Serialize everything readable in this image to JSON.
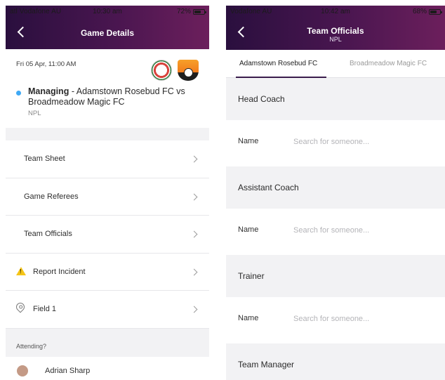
{
  "left_screen": {
    "status_bar": {
      "carrier": "atl Vodafone AU",
      "time": "10:30 am",
      "battery": "72%",
      "battery_level": 0.72
    },
    "header": {
      "title": "Game Details"
    },
    "game": {
      "date": "Fri 05 Apr, 11:00 AM",
      "status": "Managing",
      "matchup": " - Adamstown Rosebud FC vs Broadmeadow Magic FC",
      "league": "NPL"
    },
    "menu": [
      {
        "label": "Team Sheet"
      },
      {
        "label": "Game Referees"
      },
      {
        "label": "Team Officials"
      },
      {
        "label": "Report Incident"
      },
      {
        "label": "Field 1"
      }
    ],
    "attending": {
      "heading": "Attending?",
      "name": "Adrian Sharp"
    }
  },
  "right_screen": {
    "status_bar": {
      "carrier": "Vodafone AU",
      "time": "10:42 am",
      "battery": "68%",
      "battery_level": 0.68
    },
    "header": {
      "title": "Team Officials",
      "subtitle": "NPL"
    },
    "tabs": [
      {
        "label": "Adamstown Rosebud FC"
      },
      {
        "label": "Broadmeadow Magic FC"
      }
    ],
    "sections": [
      {
        "title": "Head Coach",
        "field_label": "Name",
        "placeholder": "Search for someone..."
      },
      {
        "title": "Assistant Coach",
        "field_label": "Name",
        "placeholder": "Search for someone..."
      },
      {
        "title": "Trainer",
        "field_label": "Name",
        "placeholder": "Search for someone..."
      },
      {
        "title": "Team Manager"
      }
    ]
  },
  "colors": {
    "header_gradient_start": "#2a0f3e",
    "header_gradient_end": "#6c1f5c",
    "managing_dot": "#3fa9f5",
    "warning_icon": "#f5c518"
  }
}
